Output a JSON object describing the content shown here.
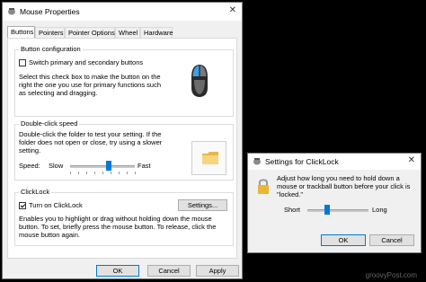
{
  "mouse_properties": {
    "title": "Mouse Properties",
    "close_glyph": "✕",
    "tabs": [
      "Buttons",
      "Pointers",
      "Pointer Options",
      "Wheel",
      "Hardware"
    ],
    "button_config": {
      "label": "Button configuration",
      "checkbox_label": "Switch primary and secondary buttons",
      "checked": false,
      "desc_lines": [
        "Select this check box to make the button on the",
        "right the one you use for primary functions such",
        "as selecting and dragging."
      ]
    },
    "double_click": {
      "label": "Double-click speed",
      "desc_lines": [
        "Double-click the folder to test your setting. If the",
        "folder does not open or close, try using a slower",
        "setting."
      ],
      "speed_label": "Speed:",
      "slow_label": "Slow",
      "fast_label": "Fast",
      "slider_value": 0.6
    },
    "clicklock": {
      "label": "ClickLock",
      "checkbox_label": "Turn on ClickLock",
      "checked": true,
      "settings_button": "Settings...",
      "desc_lines": [
        "Enables you to highlight or drag without holding down the mouse",
        "button. To set, briefly press the mouse button. To release, click the",
        "mouse button again."
      ]
    },
    "buttons": {
      "ok": "OK",
      "cancel": "Cancel",
      "apply": "Apply"
    }
  },
  "clicklock_dialog": {
    "title": "Settings for ClickLock",
    "close_glyph": "✕",
    "desc_lines": [
      "Adjust how long you need to hold down a",
      "mouse or trackball button before your click is",
      "\"locked.\""
    ],
    "short_label": "Short",
    "long_label": "Long",
    "slider_value": 0.33,
    "buttons": {
      "ok": "OK",
      "cancel": "Cancel"
    }
  },
  "watermark": "groovyPost.com"
}
